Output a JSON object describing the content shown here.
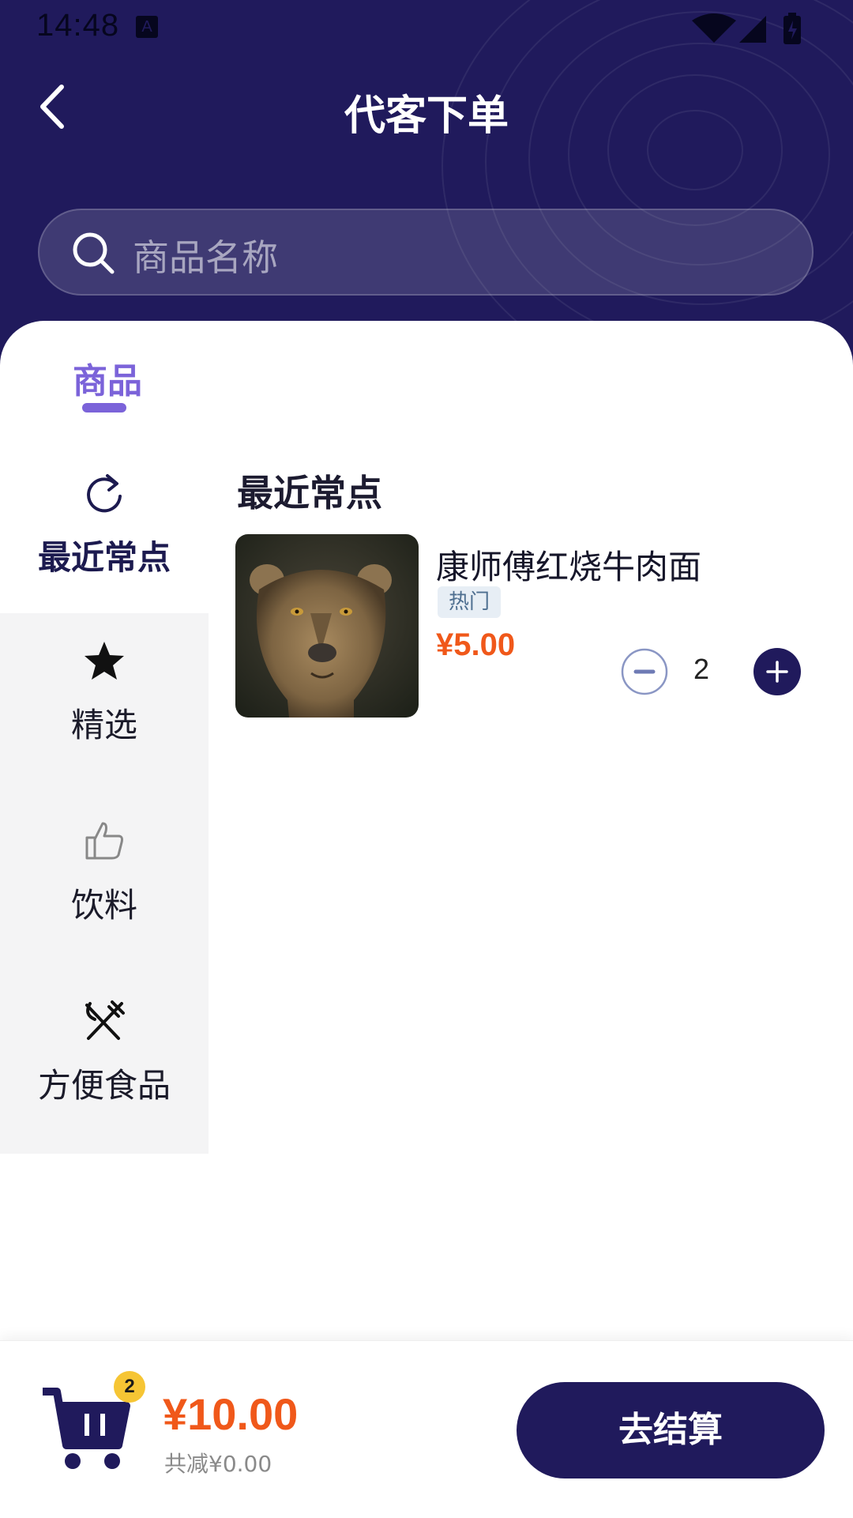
{
  "status_bar": {
    "time": "14:48",
    "notification_icon": "A"
  },
  "header": {
    "title": "代客下单",
    "back_icon": "chevron-left-icon"
  },
  "search": {
    "placeholder": "商品名称"
  },
  "tabs": [
    {
      "label": "商品",
      "active": true
    }
  ],
  "sidebar": {
    "items": [
      {
        "label": "最近常点",
        "icon": "refresh-icon",
        "active": true
      },
      {
        "label": "精选",
        "icon": "star-icon",
        "active": false
      },
      {
        "label": "饮料",
        "icon": "thumbs-up-icon",
        "active": false
      },
      {
        "label": "方便食品",
        "icon": "utensils-icon",
        "active": false
      }
    ]
  },
  "section": {
    "title": "最近常点"
  },
  "products": [
    {
      "name": "康师傅红烧牛肉面",
      "tag": "热门",
      "price": "¥5.00",
      "quantity": "2"
    }
  ],
  "footer": {
    "cart_count": "2",
    "total": "¥10.00",
    "discount": "共减¥0.00",
    "checkout_label": "去结算"
  },
  "colors": {
    "primary": "#201a5c",
    "accent": "#7b63d9",
    "price": "#f0581a",
    "badge": "#f6c534"
  }
}
